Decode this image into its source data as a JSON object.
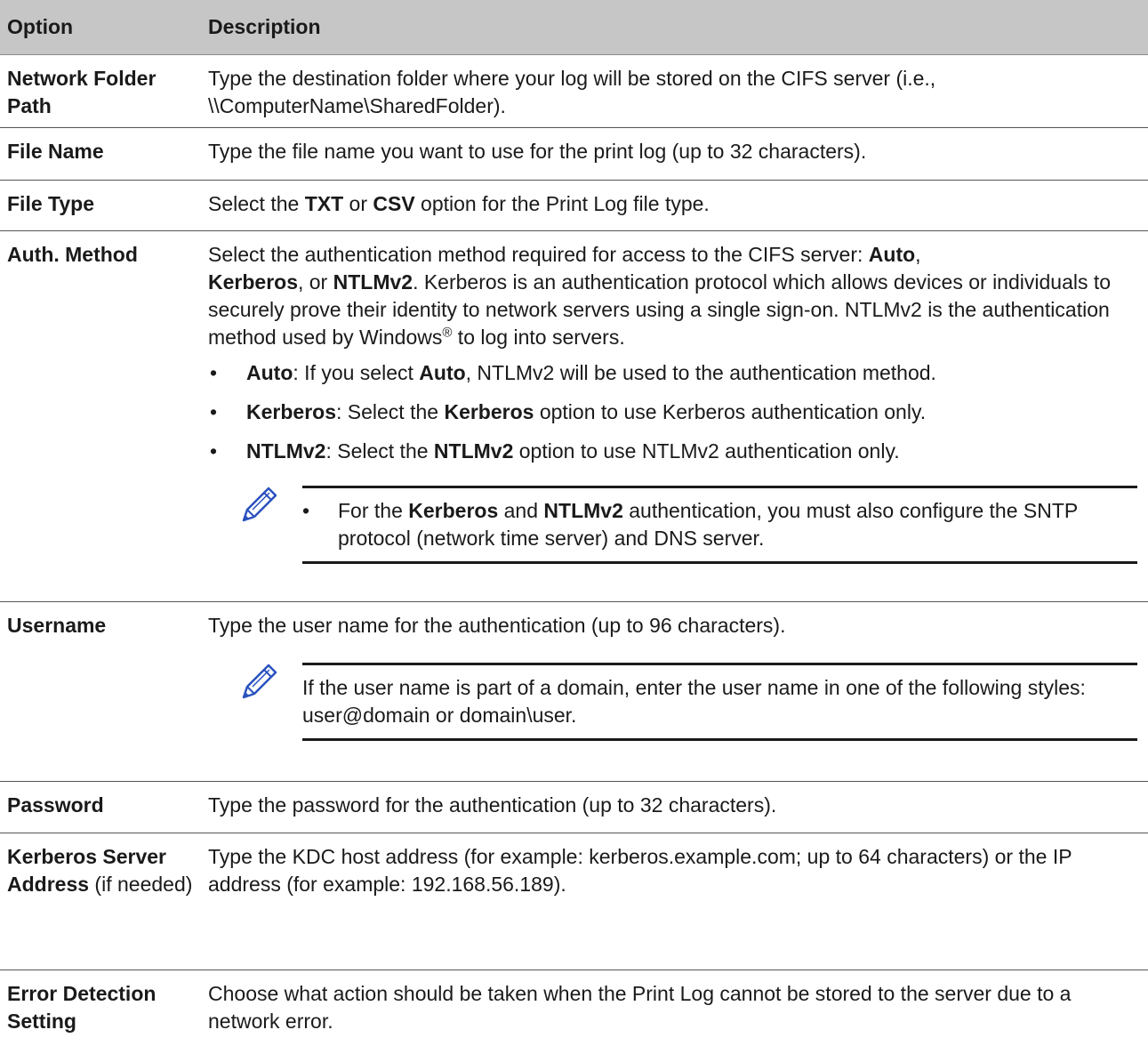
{
  "header": {
    "option": "Option",
    "description": "Description"
  },
  "rows": {
    "network_folder": {
      "name": "Network Folder Path",
      "desc": "Type the destination folder where your log will be stored on the CIFS server (i.e., \\\\ComputerName\\SharedFolder)."
    },
    "file_name": {
      "name": "File Name",
      "desc": "Type the file name you want to use for the print log (up to 32 characters)."
    },
    "file_type": {
      "name": "File Type",
      "d1": "Select the ",
      "b1": "TXT",
      "d2": " or ",
      "b2": "CSV",
      "d3": " option for the Print Log file type."
    },
    "auth_method": {
      "name": "Auth. Method",
      "p1": "Select the authentication method required for access to the CIFS server: ",
      "auto": "Auto",
      "comma": ",",
      "kerberos": "Kerberos",
      "or": ", or ",
      "ntlm": "NTLMv2",
      "p2": ". Kerberos is an authentication protocol which allows devices or individuals to securely prove their identity to network servers using a single sign-on. NTLMv2 is the authentication method used by Windows",
      "reg": "®",
      "p3": " to log into servers.",
      "bullets": [
        {
          "b": "Auto",
          "t1": ": If you select ",
          "b2": "Auto",
          "t2": ", NTLMv2 will be used to the authentication method."
        },
        {
          "b": "Kerberos",
          "t1": ": Select the ",
          "b2": "Kerberos",
          "t2": " option to use Kerberos authentication only."
        },
        {
          "b": "NTLMv2",
          "t1": ": Select the ",
          "b2": "NTLMv2",
          "t2": " option to use NTLMv2 authentication only."
        }
      ],
      "note": {
        "bullet": "•",
        "t1": "For the ",
        "b1": "Kerberos",
        "t2": " and ",
        "b2": "NTLMv2",
        "t3": " authentication, you must also configure the SNTP protocol (network time server) and DNS server."
      }
    },
    "username": {
      "name": "Username",
      "desc": "Type the user name for the authentication (up to 96 characters).",
      "note": "If the user name is part of a domain, enter the user name in one of the following styles: user@domain or domain\\user."
    },
    "password": {
      "name": "Password",
      "desc": "Type the password for the authentication (up to 32 characters)."
    },
    "kerberos_server": {
      "name": "Kerberos Server Address",
      "suffix": " (if needed)",
      "desc": "Type the KDC host address (for example: kerberos.example.com; up to 64 characters) or the IP address (for example: 192.168.56.189)."
    },
    "error_detection": {
      "name": "Error Detection Setting",
      "desc": "Choose what action should be taken when the Print Log cannot be stored to the server due to a network error."
    }
  },
  "icons": {
    "note_icon": "pencil-icon",
    "note_icon_color": "#2a52be"
  }
}
